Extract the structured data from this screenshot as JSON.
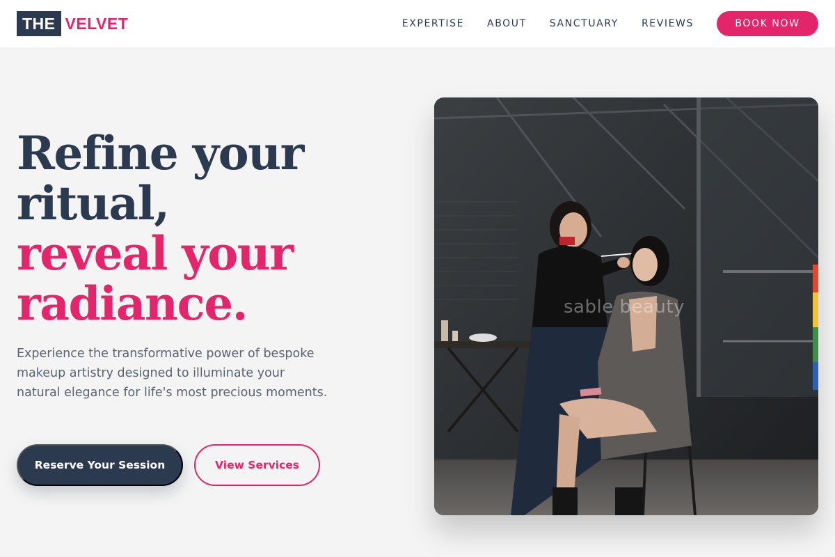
{
  "brand": {
    "logo_part1": "THE",
    "logo_part2": "VELVET"
  },
  "nav": {
    "links": [
      "EXPERTISE",
      "ABOUT",
      "SANCTUARY",
      "REVIEWS"
    ],
    "cta": "BOOK NOW"
  },
  "hero": {
    "title_line1": "Refine your",
    "title_line2": "ritual,",
    "title_line3": "reveal your",
    "title_line4": "radiance.",
    "description": "Experience the transformative power of bespoke makeup artistry designed to illuminate your natural elegance for life's most precious moments.",
    "primary_button": "Reserve Your Session",
    "secondary_button": "View Services",
    "image_watermark": "sable beauty"
  },
  "colors": {
    "navy": "#2b3a4e",
    "accent": "#e3266b",
    "background": "#f4f4f4"
  }
}
